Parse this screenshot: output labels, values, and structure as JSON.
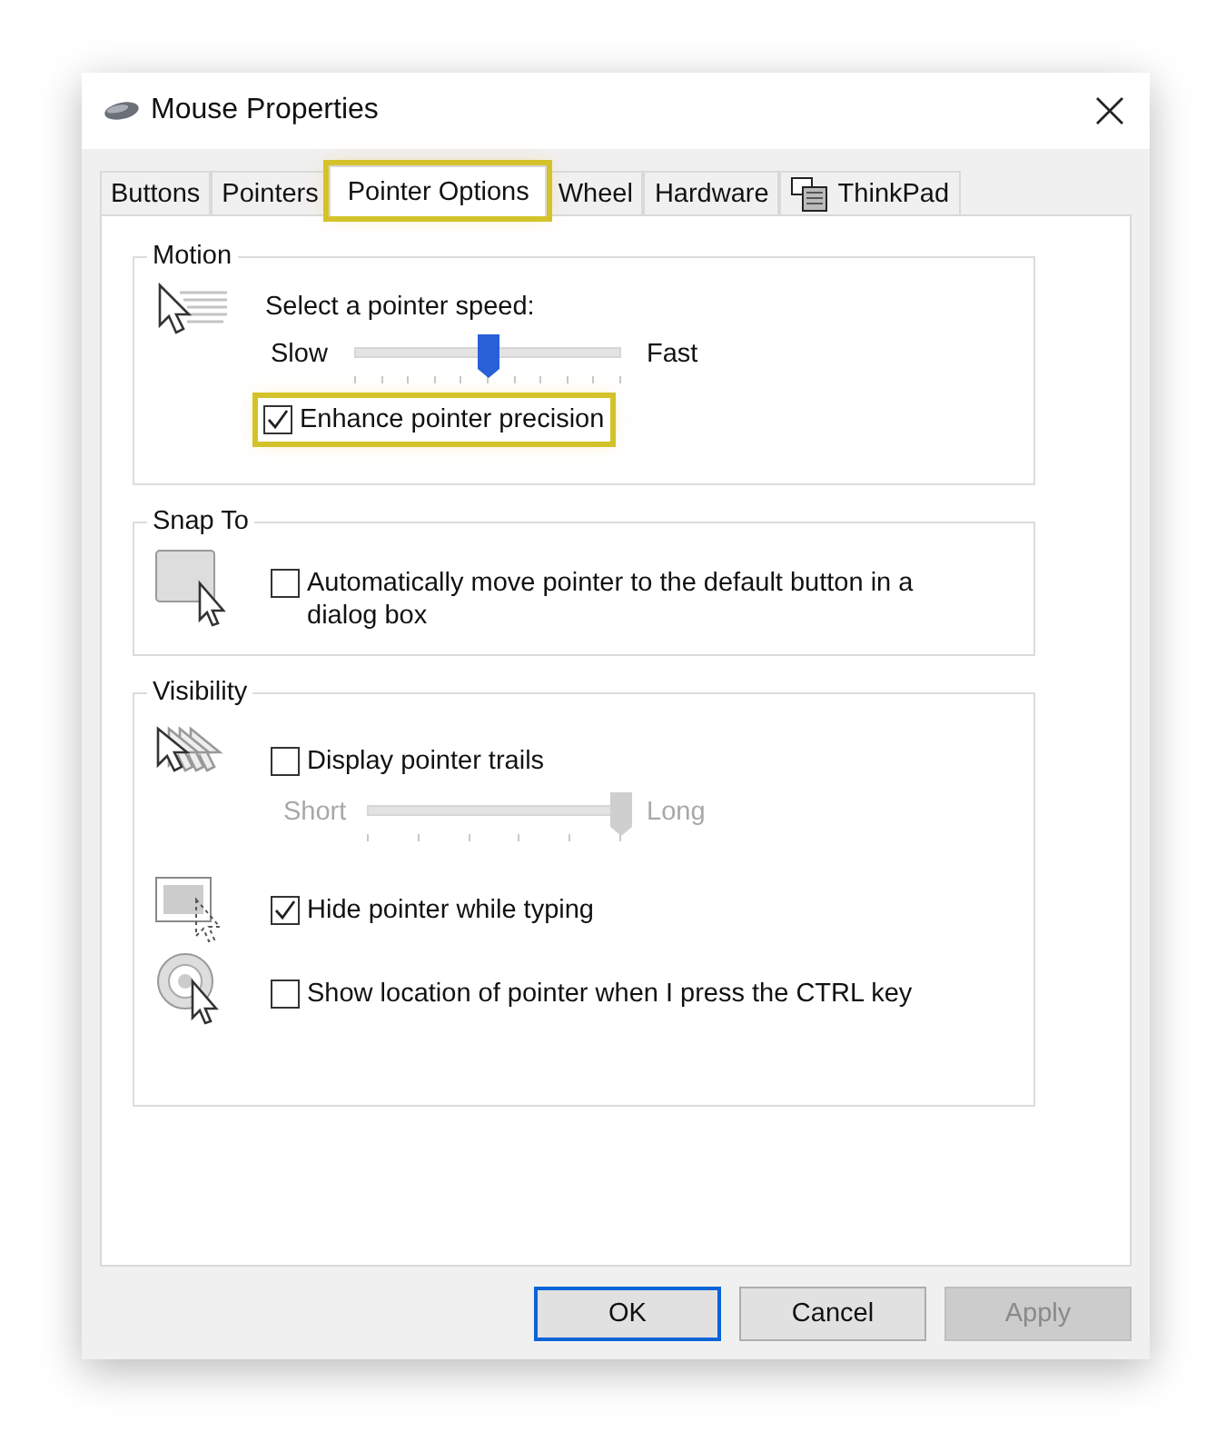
{
  "window": {
    "title": "Mouse Properties"
  },
  "tabs": [
    {
      "label": "Buttons",
      "selected": false,
      "highlighted": false,
      "kind": "text"
    },
    {
      "label": "Pointers",
      "selected": false,
      "highlighted": false,
      "kind": "text"
    },
    {
      "label": "Pointer Options",
      "selected": true,
      "highlighted": true,
      "kind": "text"
    },
    {
      "label": "Wheel",
      "selected": false,
      "highlighted": false,
      "kind": "text"
    },
    {
      "label": "Hardware",
      "selected": false,
      "highlighted": false,
      "kind": "text"
    },
    {
      "label": "ThinkPad",
      "selected": false,
      "highlighted": false,
      "kind": "icon"
    }
  ],
  "motion": {
    "title": "Motion",
    "prompt": "Select a pointer speed:",
    "slider": {
      "min_label": "Slow",
      "max_label": "Fast",
      "level": 0.5,
      "disabled": false
    },
    "checkbox": {
      "label": "Enhance pointer precision",
      "checked": true,
      "highlighted": true
    }
  },
  "snap_to": {
    "title": "Snap To",
    "checkbox": {
      "label": "Automatically move pointer to the default button in a dialog box",
      "checked": false,
      "highlighted": false
    }
  },
  "visibility": {
    "title": "Visibility",
    "trails": {
      "label": "Display pointer trails",
      "checked": false,
      "highlighted": false
    },
    "trail_slider": {
      "min_label": "Short",
      "max_label": "Long",
      "level": 1,
      "disabled": true
    },
    "hide_while_typing": {
      "label": "Hide pointer while typing",
      "checked": true,
      "highlighted": false
    },
    "show_location": {
      "label": "Show location of pointer when I press the CTRL key",
      "checked": false,
      "highlighted": false
    }
  },
  "buttons": [
    {
      "label": "OK",
      "default": true,
      "disabled": false
    },
    {
      "label": "Cancel",
      "default": false,
      "disabled": false
    },
    {
      "label": "Apply",
      "default": false,
      "disabled": true
    }
  ]
}
